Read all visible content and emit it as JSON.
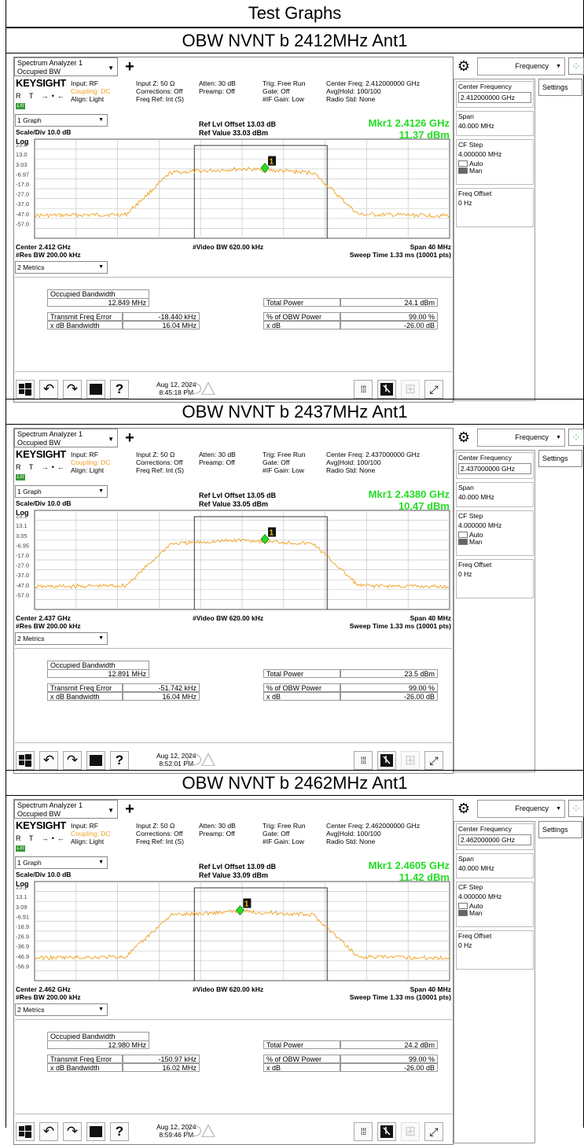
{
  "page_title": "Test Graphs",
  "panels": [
    {
      "section_title": "OBW NVNT b 2412MHz Ant1",
      "window": {
        "title_line1": "Spectrum Analyzer 1",
        "title_line2": "Occupied BW"
      },
      "info": {
        "brand": "KEYSIGHT",
        "rt": "R T",
        "input": "Input: RF",
        "coupling": "Coupling: DC",
        "align": "Align: Light",
        "inputz": "Input Z: 50 Ω",
        "corrections": "Corrections: Off",
        "freqref": "Freq Ref: Int (S)",
        "atten": "Atten: 30 dB",
        "preamp": "Preamp: Off",
        "trig": "Trig: Free Run",
        "gate": "Gate: Off",
        "ifgain": "#IF Gain: Low",
        "cf": "Center Freq: 2.412000000 GHz",
        "avg": "Avg|Hold: 100/100",
        "radio": "Radio Std: None"
      },
      "graph": {
        "view": "1 Graph",
        "scale": "Scale/Div 10.0 dB",
        "ref_offset": "Ref Lvl Offset 13.03 dB",
        "ref_value": "Ref Value 33.03 dBm",
        "mkr_freq": "Mkr1  2.4126 GHz",
        "mkr_level": "11.37 dBm",
        "log": "Log",
        "y_ticks": [
          "23.0",
          "13.0",
          "3.03",
          "-6.97",
          "-17.0",
          "-27.0",
          "-37.0",
          "-47.0",
          "-57.0"
        ],
        "marker_label": "1",
        "center": "Center 2.412 GHz",
        "vbw": "#Video BW 620.00 kHz",
        "span": "Span 40 MHz",
        "rbw": "#Res BW 200.00 kHz",
        "sweep": "Sweep Time 1.33 ms (10001 pts)"
      },
      "metrics": {
        "view": "2 Metrics",
        "obw_label": "Occupied Bandwidth",
        "obw_value": "12.849 MHz",
        "tfe_label": "Transmit Freq Error",
        "tfe_value": "-18.440 kHz",
        "xdbbw_label": "x dB Bandwidth",
        "xdbbw_value": "16.04 MHz",
        "tp_label": "Total Power",
        "tp_value": "24.1 dBm",
        "pct_label": "% of OBW Power",
        "pct_value": "99.00 %",
        "xdb_label": "x dB",
        "xdb_value": "-26.00 dB"
      },
      "datetime": {
        "date": "Aug 12, 2024",
        "time": "8:45:18 PM"
      },
      "side": {
        "menu": "Frequency",
        "settings": "Settings",
        "cf_label": "Center Frequency",
        "cf_value": "2.412000000 GHz",
        "span_label": "Span",
        "span_value": "40.000 MHz",
        "step_label": "CF Step",
        "step_value": "4.000000 MHz",
        "auto": "Auto",
        "man": "Man",
        "offset_label": "Freq Offset",
        "offset_value": "0 Hz"
      }
    },
    {
      "section_title": "OBW NVNT b 2437MHz Ant1",
      "window": {
        "title_line1": "Spectrum Analyzer 1",
        "title_line2": "Occupied BW"
      },
      "info": {
        "brand": "KEYSIGHT",
        "rt": "R T",
        "input": "Input: RF",
        "coupling": "Coupling: DC",
        "align": "Align: Light",
        "inputz": "Input Z: 50 Ω",
        "corrections": "Corrections: Off",
        "freqref": "Freq Ref: Int (S)",
        "atten": "Atten: 30 dB",
        "preamp": "Preamp: Off",
        "trig": "Trig: Free Run",
        "gate": "Gate: Off",
        "ifgain": "#IF Gain: Low",
        "cf": "Center Freq: 2.437000000 GHz",
        "avg": "Avg|Hold: 100/100",
        "radio": "Radio Std: None"
      },
      "graph": {
        "view": "1 Graph",
        "scale": "Scale/Div 10.0 dB",
        "ref_offset": "Ref Lvl Offset 13.05 dB",
        "ref_value": "Ref Value 33.05 dBm",
        "mkr_freq": "Mkr1  2.4380 GHz",
        "mkr_level": "10.47 dBm",
        "log": "Log",
        "y_ticks": [
          "23.1",
          "13.1",
          "3.05",
          "-6.95",
          "-17.0",
          "-27.0",
          "-37.0",
          "-47.0",
          "-57.0"
        ],
        "marker_label": "1",
        "center": "Center 2.437 GHz",
        "vbw": "#Video BW 620.00 kHz",
        "span": "Span 40 MHz",
        "rbw": "#Res BW 200.00 kHz",
        "sweep": "Sweep Time 1.33 ms (10001 pts)"
      },
      "metrics": {
        "view": "2 Metrics",
        "obw_label": "Occupied Bandwidth",
        "obw_value": "12.891 MHz",
        "tfe_label": "Transmit Freq Error",
        "tfe_value": "-51.742 kHz",
        "xdbbw_label": "x dB Bandwidth",
        "xdbbw_value": "16.04 MHz",
        "tp_label": "Total Power",
        "tp_value": "23.5 dBm",
        "pct_label": "% of OBW Power",
        "pct_value": "99.00 %",
        "xdb_label": "x dB",
        "xdb_value": "-26.00 dB"
      },
      "datetime": {
        "date": "Aug 12, 2024",
        "time": "8:52:01 PM"
      },
      "side": {
        "menu": "Frequency",
        "settings": "Settings",
        "cf_label": "Center Frequency",
        "cf_value": "2.437000000 GHz",
        "span_label": "Span",
        "span_value": "40.000 MHz",
        "step_label": "CF Step",
        "step_value": "4.000000 MHz",
        "auto": "Auto",
        "man": "Man",
        "offset_label": "Freq Offset",
        "offset_value": "0 Hz"
      }
    },
    {
      "section_title": "OBW NVNT b 2462MHz Ant1",
      "window": {
        "title_line1": "Spectrum Analyzer 1",
        "title_line2": "Occupied BW"
      },
      "info": {
        "brand": "KEYSIGHT",
        "rt": "R T",
        "input": "Input: RF",
        "coupling": "Coupling: DC",
        "align": "Align: Light",
        "inputz": "Input Z: 50 Ω",
        "corrections": "Corrections: Off",
        "freqref": "Freq Ref: Int (S)",
        "atten": "Atten: 30 dB",
        "preamp": "Preamp: Off",
        "trig": "Trig: Free Run",
        "gate": "Gate: Off",
        "ifgain": "#IF Gain: Low",
        "cf": "Center Freq: 2.462000000 GHz",
        "avg": "Avg|Hold: 100/100",
        "radio": "Radio Std: None"
      },
      "graph": {
        "view": "1 Graph",
        "scale": "Scale/Div 10.0 dB",
        "ref_offset": "Ref Lvl Offset 13.09 dB",
        "ref_value": "Ref Value 33.09 dBm",
        "mkr_freq": "Mkr1  2.4605 GHz",
        "mkr_level": "11.42 dBm",
        "log": "Log",
        "y_ticks": [
          "23.1",
          "13.1",
          "3.09",
          "-6.91",
          "-16.9",
          "-26.9",
          "-36.9",
          "-46.9",
          "-56.9"
        ],
        "marker_label": "1",
        "center": "Center 2.462 GHz",
        "vbw": "#Video BW 620.00 kHz",
        "span": "Span 40 MHz",
        "rbw": "#Res BW 200.00 kHz",
        "sweep": "Sweep Time 1.33 ms (10001 pts)"
      },
      "metrics": {
        "view": "2 Metrics",
        "obw_label": "Occupied Bandwidth",
        "obw_value": "12.980 MHz",
        "tfe_label": "Transmit Freq Error",
        "tfe_value": "-150.97 kHz",
        "xdbbw_label": "x dB Bandwidth",
        "xdbbw_value": "16.02 MHz",
        "tp_label": "Total Power",
        "tp_value": "24.2 dBm",
        "pct_label": "% of OBW Power",
        "pct_value": "99.00 %",
        "xdb_label": "x dB",
        "xdb_value": "-26.00 dB"
      },
      "datetime": {
        "date": "Aug 12, 2024",
        "time": "8:59:46 PM"
      },
      "side": {
        "menu": "Frequency",
        "settings": "Settings",
        "cf_label": "Center Frequency",
        "cf_value": "2.462000000 GHz",
        "span_label": "Span",
        "span_value": "40.000 MHz",
        "step_label": "CF Step",
        "step_value": "4.000000 MHz",
        "auto": "Auto",
        "man": "Man",
        "offset_label": "Freq Offset",
        "offset_value": "0 Hz"
      }
    }
  ],
  "colors": {
    "trace": "#f0a020",
    "marker": "#22dd22",
    "grid": "#c8c8c8"
  },
  "icons": [
    "windows-icon",
    "undo-icon",
    "redo-icon",
    "folder-icon",
    "help-icon",
    "grid-icon",
    "touch-icon",
    "layout-icon",
    "fullscreen-icon",
    "gear-icon",
    "spinner-icon"
  ]
}
